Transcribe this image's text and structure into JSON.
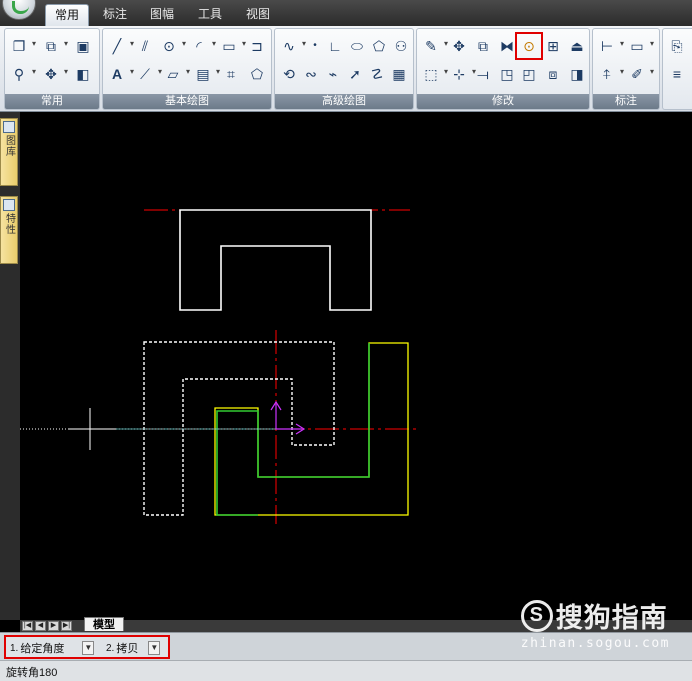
{
  "ribbon": {
    "tabs": [
      {
        "label": "常用",
        "active": true
      },
      {
        "label": "标注",
        "active": false
      },
      {
        "label": "图幅",
        "active": false
      },
      {
        "label": "工具",
        "active": false
      },
      {
        "label": "视图",
        "active": false
      }
    ],
    "groups": [
      {
        "label": "常用"
      },
      {
        "label": "基本绘图"
      },
      {
        "label": "高级绘图"
      },
      {
        "label": "修改"
      },
      {
        "label": "标注"
      }
    ],
    "highlighted_tool": "rotate-icon",
    "highlight_color": "#e00000"
  },
  "palette": {
    "tabs": [
      {
        "label": "图库",
        "icon": "library-icon"
      },
      {
        "label": "特性",
        "icon": "properties-icon"
      }
    ]
  },
  "layout": {
    "nav": [
      "|◀",
      "◀",
      "▶",
      "▶|"
    ],
    "model_tab": "模型"
  },
  "options": {
    "option1": {
      "num": "1.",
      "value": "给定角度"
    },
    "option2": {
      "num": "2.",
      "value": "拷贝"
    }
  },
  "status": {
    "command": "旋转角180"
  },
  "watermark": {
    "brand": "搜狗指南",
    "url": "zhinan.sogou.com"
  },
  "colors": {
    "canvas": "#000000",
    "original_outline": "#ffffff",
    "rotated_preview": "#33cc33",
    "selection_preview": "#ffff00",
    "center_line": "#ff0000",
    "highlight": "#e00000"
  }
}
